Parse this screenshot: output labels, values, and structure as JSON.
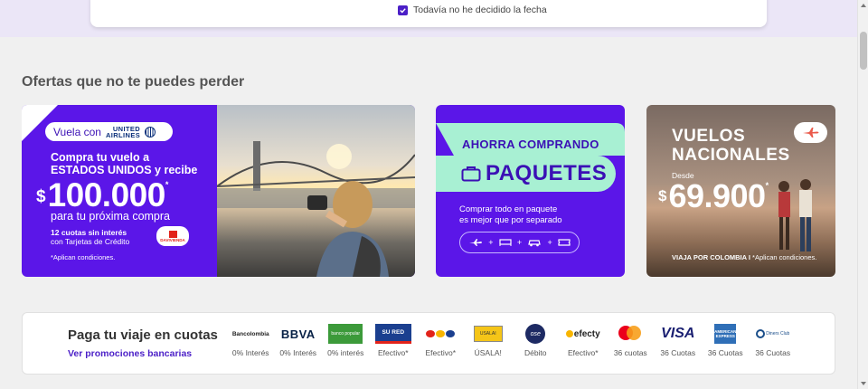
{
  "search": {
    "undecided_label": "Todavía no he decidido la fecha",
    "undecided_checked": true
  },
  "offers": {
    "title": "Ofertas que no te puedes perder",
    "banner_united": {
      "vuela_con": "Vuela con",
      "airline_line1": "UNITED",
      "airline_line2": "AIRLINES",
      "line1": "Compra tu vuelo a",
      "line2": "ESTADOS UNIDOS y recibe",
      "currency": "$",
      "amount": "100.000",
      "asterisk": "*",
      "line3": "para tu próxima compra",
      "cuotas": "12 cuotas sin interés",
      "tarjetas": "con Tarjetas de Crédito",
      "bank": "DAVIVIENDA",
      "conditions": "*Aplican condiciones."
    },
    "banner_paquetes": {
      "headline": "AHORRA COMPRANDO",
      "product": "PAQUETES",
      "body_line1": "Comprar todo en paquete",
      "body_line2": "es mejor que por separado",
      "plus": "+"
    },
    "banner_nacionales": {
      "title_line1": "VUELOS",
      "title_line2": "NACIONALES",
      "desde": "Desde",
      "currency": "$",
      "amount": "69.900",
      "asterisk": "*",
      "footer_bold": "VIAJA POR COLOMBIA I",
      "footer_rest": " *Aplican condiciones."
    }
  },
  "installments": {
    "title": "Paga tu viaje en cuotas",
    "link": "Ver promociones bancarias",
    "methods": [
      {
        "logo": "Bancolombia",
        "label": "0% Interés"
      },
      {
        "logo": "BBVA",
        "label": "0% Interés"
      },
      {
        "logo": "banco popular",
        "label": "0% interés"
      },
      {
        "logo": "SU RED",
        "label": "Efectivo*"
      },
      {
        "logo": "efectivo",
        "label": "Efectivo*"
      },
      {
        "logo": "USALAI",
        "label": "ÚSALA!"
      },
      {
        "logo": "ose",
        "label": "Débito"
      },
      {
        "logo": "efecty",
        "label": "Efectivo*"
      },
      {
        "logo": "mastercard",
        "label": "36 cuotas"
      },
      {
        "logo": "VISA",
        "label": "36 Cuotas"
      },
      {
        "logo": "AMERICAN EXPRESS",
        "label": "36 Cuotas"
      },
      {
        "logo": "Diners Club",
        "label": "36 Cuotas"
      }
    ]
  },
  "colors": {
    "brand_purple": "#5b16e8",
    "mint": "#a8f0d3",
    "link_purple": "#4b1fc7"
  }
}
